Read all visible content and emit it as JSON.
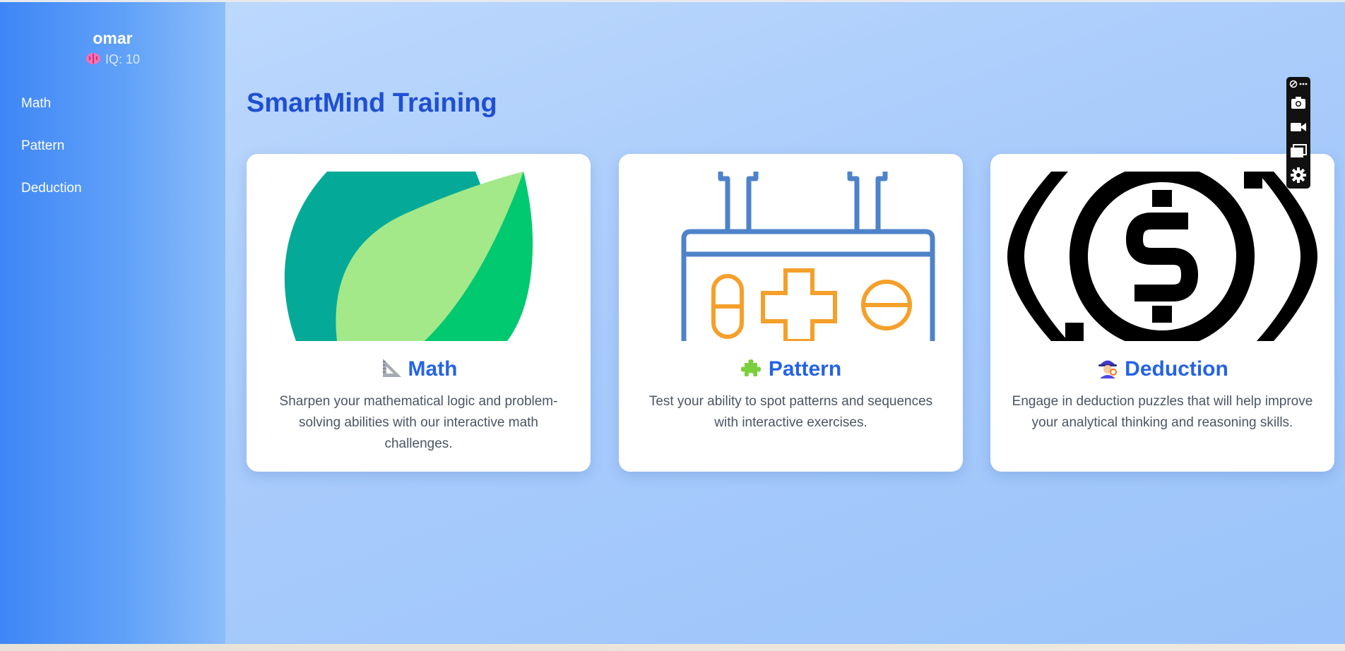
{
  "sidebar": {
    "username": "omar",
    "iq_text": "IQ: 10",
    "items": [
      {
        "label": "Math"
      },
      {
        "label": "Pattern"
      },
      {
        "label": "Deduction"
      }
    ]
  },
  "main": {
    "title": "SmartMind Training",
    "cards": [
      {
        "title": "Math",
        "emoji_icon": "triangular-ruler-icon",
        "description": "Sharpen your mathematical logic and problem-solving abilities with our interactive math challenges."
      },
      {
        "title": "Pattern",
        "emoji_icon": "puzzle-piece-icon",
        "description": "Test your ability to spot patterns and sequences with interactive exercises."
      },
      {
        "title": "Deduction",
        "emoji_icon": "detective-icon",
        "description": "Engage in deduction puzzles that will help improve your analytical thinking and reasoning skills."
      }
    ]
  },
  "toolbar": {
    "icons": [
      "extension-icon",
      "more-icon",
      "camera-icon",
      "video-icon",
      "window-icon",
      "settings-icon"
    ]
  },
  "colors": {
    "accent": "#2563e6",
    "title": "#1f4fd3",
    "sidebar_start": "#3f86f6",
    "sidebar_end": "#8cbdfa"
  }
}
